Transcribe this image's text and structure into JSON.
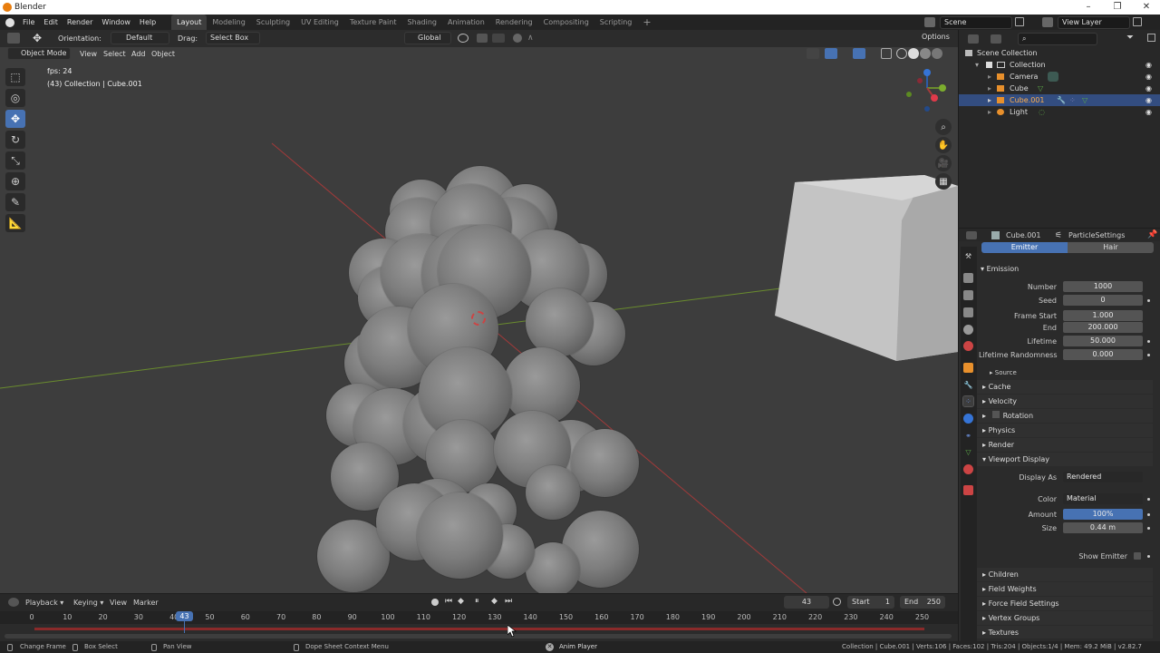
{
  "window": {
    "title": "Blender",
    "min_glyph": "–",
    "max_glyph": "❐",
    "close_glyph": "✕"
  },
  "menu": {
    "items": [
      "File",
      "Edit",
      "Render",
      "Window",
      "Help"
    ]
  },
  "workspaces": {
    "tabs": [
      "Layout",
      "Modeling",
      "Sculpting",
      "UV Editing",
      "Texture Paint",
      "Shading",
      "Animation",
      "Rendering",
      "Compositing",
      "Scripting"
    ],
    "active": "Layout",
    "add_glyph": "+"
  },
  "scene": {
    "name": "Scene",
    "view_layer": "View Layer"
  },
  "viewport_header": {
    "orientation_label": "Orientation:",
    "orientation_value": "Default",
    "drag_label": "Drag:",
    "drag_value": "Select Box",
    "transform_orientation": "Global",
    "options_label": "Options",
    "mode": "Object Mode",
    "view_menu": "View",
    "select_menu": "Select",
    "add_menu": "Add",
    "object_menu": "Object"
  },
  "viewport_overlay": {
    "fps": "fps: 24",
    "context": "(43) Collection | Cube.001"
  },
  "outliner": {
    "root": "Scene Collection",
    "collection": "Collection",
    "items": [
      "Camera",
      "Cube",
      "Cube.001",
      "Light"
    ],
    "selected": "Cube.001"
  },
  "properties": {
    "object_name": "Cube.001",
    "settings_name": "ParticleSettings",
    "tabs": [
      "Emitter",
      "Hair"
    ],
    "active_tab": "Emitter",
    "emission": {
      "header": "Emission",
      "number_label": "Number",
      "number": "1000",
      "seed_label": "Seed",
      "seed": "0",
      "frame_start_label": "Frame Start",
      "frame_start": "1.000",
      "end_label": "End",
      "end": "200.000",
      "lifetime_label": "Lifetime",
      "lifetime": "50.000",
      "lifetime_random_label": "Lifetime Randomness",
      "lifetime_random": "0.000",
      "source_label": "Source"
    },
    "sections": [
      "Cache",
      "Velocity",
      "Rotation",
      "Physics",
      "Render",
      "Viewport Display"
    ],
    "viewport_display": {
      "display_as_label": "Display As",
      "display_as": "Rendered",
      "color_label": "Color",
      "color": "Material",
      "amount_label": "Amount",
      "amount": "100%",
      "amount_fraction": 1.0,
      "size_label": "Size",
      "size": "0.44 m",
      "show_emitter_label": "Show Emitter"
    },
    "bottom_sections": [
      "Children",
      "Field Weights",
      "Force Field Settings",
      "Vertex Groups",
      "Textures"
    ]
  },
  "timeline": {
    "menus": [
      "Playback",
      "Keying",
      "View",
      "Marker"
    ],
    "current_frame": "43",
    "start_label": "Start",
    "start": "1",
    "end_label": "End",
    "end": "250",
    "ticks": [
      "0",
      "10",
      "20",
      "30",
      "40",
      "50",
      "60",
      "70",
      "80",
      "90",
      "100",
      "110",
      "120",
      "130",
      "140",
      "150",
      "160",
      "170",
      "180",
      "190",
      "200",
      "210",
      "220",
      "230",
      "240",
      "250"
    ]
  },
  "statusbar": {
    "change_frame": "Change Frame",
    "box_select": "Box Select",
    "pan_view": "Pan View",
    "context_menu": "Dope Sheet Context Menu",
    "anim_player": "Anim Player",
    "stats": "Collection | Cube.001 | Verts:106 | Faces:102 | Tris:204 | Objects:1/4 | Mem: 49.2 MiB | v2.82.7"
  },
  "colors": {
    "accent": "#4772b3",
    "selection": "#334d80",
    "red_axis": "#a33a3a",
    "green_axis": "#6a8c2e"
  }
}
